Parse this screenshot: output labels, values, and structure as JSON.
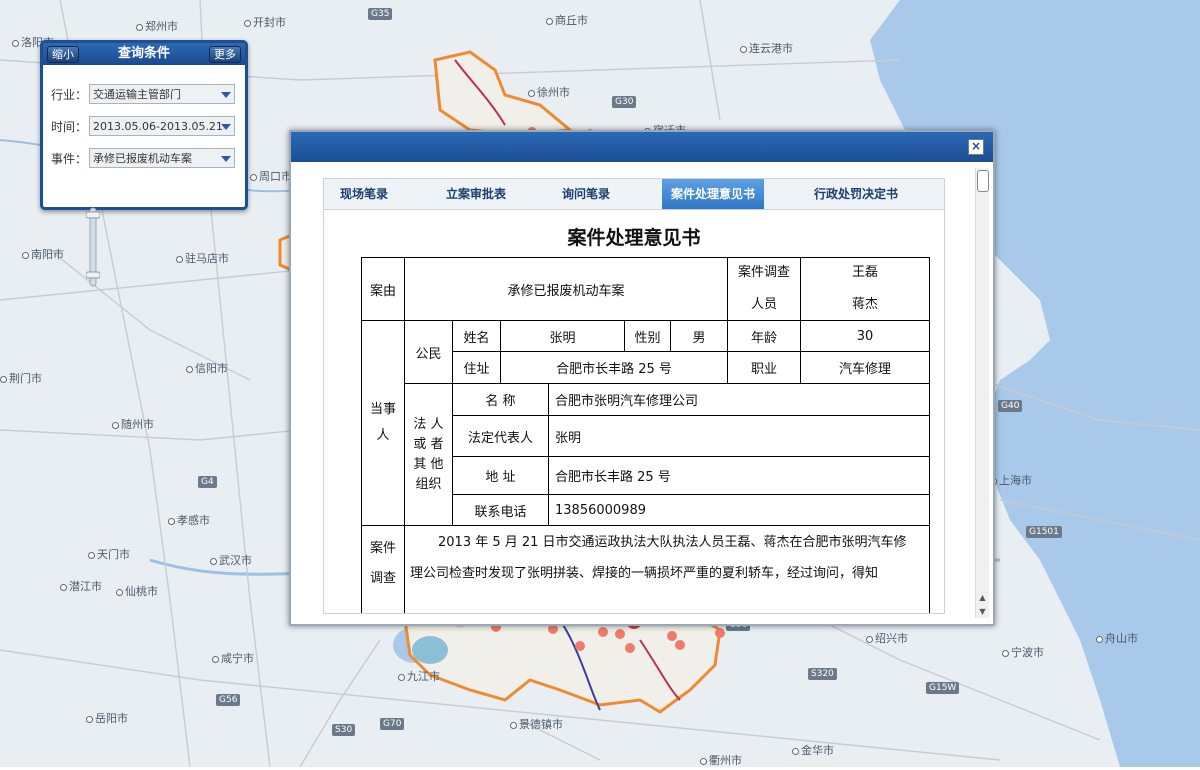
{
  "map": {
    "cities": [
      "洛阳市",
      "郑州市",
      "开封市",
      "商丘市",
      "连云港市",
      "徐州市",
      "宿迁市",
      "周口市",
      "驻马店市",
      "南阳市",
      "信阳市",
      "随州市",
      "孝感市",
      "天门市",
      "武汉市",
      "潜江市",
      "仙桃市",
      "咸宁市",
      "岳阳市",
      "九江市",
      "景德镇市",
      "金华市",
      "衢州市",
      "绍兴市",
      "宁波市",
      "舟山市",
      "上海市",
      "荆门市"
    ],
    "highways": [
      "G35",
      "G30",
      "G4",
      "G40",
      "G1501",
      "G56",
      "S30",
      "G70",
      "G56",
      "G15W",
      "S320"
    ],
    "colors": {
      "water": "#a8c8ea",
      "land": "#e8eef2",
      "highlight_border": "#f08a30"
    }
  },
  "query_panel": {
    "title": "查询条件",
    "shrink_label": "缩小",
    "more_label": "更多",
    "industry_label": "行业：",
    "industry_value": "交通运输主管部门",
    "time_label": "时间：",
    "time_value": "2013.05.06-2013.05.21",
    "event_label": "事件：",
    "event_value": "承修已报废机动车案"
  },
  "dialog": {
    "close_label": "×",
    "tabs": [
      {
        "label": "现场笔录",
        "active": false
      },
      {
        "label": "立案审批表",
        "active": false
      },
      {
        "label": "询问笔录",
        "active": false
      },
      {
        "label": "案件处理意见书",
        "active": true
      },
      {
        "label": "行政处罚决定书",
        "active": false
      }
    ],
    "document": {
      "title": "案件处理意见书",
      "case_reason_label": "案由",
      "case_reason_value": "承修已报废机动车案",
      "investigator_label_1": "案件调查",
      "investigator_label_2": "人员",
      "investigator_1": "王磊",
      "investigator_2": "蒋杰",
      "party_label_1": "当事",
      "party_label_2": "人",
      "citizen_label": "公民",
      "name_label": "姓名",
      "name_value": "张明",
      "gender_label": "性别",
      "gender_value": "男",
      "age_label": "年龄",
      "age_value": "30",
      "address_label": "住址",
      "address_value": "合肥市长丰路 25 号",
      "job_label": "职业",
      "job_value": "汽车修理",
      "org_label_1": "法 人",
      "org_label_2": "或 者",
      "org_label_3": "其 他",
      "org_label_4": "组织",
      "org_name_label": "名 称",
      "org_name_value": "合肥市张明汽车修理公司",
      "legal_rep_label": "法定代表人",
      "legal_rep_value": "张明",
      "org_address_label": "地 址",
      "org_address_value": "合肥市长丰路 25 号",
      "phone_label": "联系电话",
      "phone_value": "13856000989",
      "investigation_label_1": "案件",
      "investigation_label_2": "调查",
      "investigation_line_1": "2013 年 5 月 21 日市交通运政执法大队执法人员王磊、蒋杰在合肥市张明汽车修",
      "investigation_line_2": "理公司检查时发现了张明拼装、焊接的一辆损坏严重的夏利轿车，经过询问，得知"
    }
  }
}
